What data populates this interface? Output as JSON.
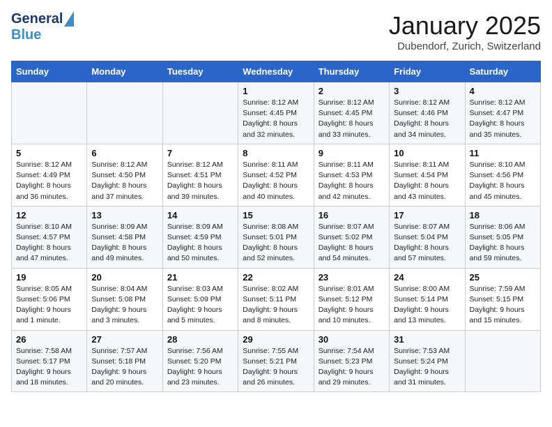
{
  "header": {
    "logo_line1": "General",
    "logo_line2": "Blue",
    "title": "January 2025",
    "subtitle": "Dubendorf, Zurich, Switzerland"
  },
  "days_of_week": [
    "Sunday",
    "Monday",
    "Tuesday",
    "Wednesday",
    "Thursday",
    "Friday",
    "Saturday"
  ],
  "weeks": [
    [
      {
        "date": "",
        "info": ""
      },
      {
        "date": "",
        "info": ""
      },
      {
        "date": "",
        "info": ""
      },
      {
        "date": "1",
        "info": "Sunrise: 8:12 AM\nSunset: 4:45 PM\nDaylight: 8 hours\nand 32 minutes."
      },
      {
        "date": "2",
        "info": "Sunrise: 8:12 AM\nSunset: 4:45 PM\nDaylight: 8 hours\nand 33 minutes."
      },
      {
        "date": "3",
        "info": "Sunrise: 8:12 AM\nSunset: 4:46 PM\nDaylight: 8 hours\nand 34 minutes."
      },
      {
        "date": "4",
        "info": "Sunrise: 8:12 AM\nSunset: 4:47 PM\nDaylight: 8 hours\nand 35 minutes."
      }
    ],
    [
      {
        "date": "5",
        "info": "Sunrise: 8:12 AM\nSunset: 4:49 PM\nDaylight: 8 hours\nand 36 minutes."
      },
      {
        "date": "6",
        "info": "Sunrise: 8:12 AM\nSunset: 4:50 PM\nDaylight: 8 hours\nand 37 minutes."
      },
      {
        "date": "7",
        "info": "Sunrise: 8:12 AM\nSunset: 4:51 PM\nDaylight: 8 hours\nand 39 minutes."
      },
      {
        "date": "8",
        "info": "Sunrise: 8:11 AM\nSunset: 4:52 PM\nDaylight: 8 hours\nand 40 minutes."
      },
      {
        "date": "9",
        "info": "Sunrise: 8:11 AM\nSunset: 4:53 PM\nDaylight: 8 hours\nand 42 minutes."
      },
      {
        "date": "10",
        "info": "Sunrise: 8:11 AM\nSunset: 4:54 PM\nDaylight: 8 hours\nand 43 minutes."
      },
      {
        "date": "11",
        "info": "Sunrise: 8:10 AM\nSunset: 4:56 PM\nDaylight: 8 hours\nand 45 minutes."
      }
    ],
    [
      {
        "date": "12",
        "info": "Sunrise: 8:10 AM\nSunset: 4:57 PM\nDaylight: 8 hours\nand 47 minutes."
      },
      {
        "date": "13",
        "info": "Sunrise: 8:09 AM\nSunset: 4:58 PM\nDaylight: 8 hours\nand 49 minutes."
      },
      {
        "date": "14",
        "info": "Sunrise: 8:09 AM\nSunset: 4:59 PM\nDaylight: 8 hours\nand 50 minutes."
      },
      {
        "date": "15",
        "info": "Sunrise: 8:08 AM\nSunset: 5:01 PM\nDaylight: 8 hours\nand 52 minutes."
      },
      {
        "date": "16",
        "info": "Sunrise: 8:07 AM\nSunset: 5:02 PM\nDaylight: 8 hours\nand 54 minutes."
      },
      {
        "date": "17",
        "info": "Sunrise: 8:07 AM\nSunset: 5:04 PM\nDaylight: 8 hours\nand 57 minutes."
      },
      {
        "date": "18",
        "info": "Sunrise: 8:06 AM\nSunset: 5:05 PM\nDaylight: 8 hours\nand 59 minutes."
      }
    ],
    [
      {
        "date": "19",
        "info": "Sunrise: 8:05 AM\nSunset: 5:06 PM\nDaylight: 9 hours\nand 1 minute."
      },
      {
        "date": "20",
        "info": "Sunrise: 8:04 AM\nSunset: 5:08 PM\nDaylight: 9 hours\nand 3 minutes."
      },
      {
        "date": "21",
        "info": "Sunrise: 8:03 AM\nSunset: 5:09 PM\nDaylight: 9 hours\nand 5 minutes."
      },
      {
        "date": "22",
        "info": "Sunrise: 8:02 AM\nSunset: 5:11 PM\nDaylight: 9 hours\nand 8 minutes."
      },
      {
        "date": "23",
        "info": "Sunrise: 8:01 AM\nSunset: 5:12 PM\nDaylight: 9 hours\nand 10 minutes."
      },
      {
        "date": "24",
        "info": "Sunrise: 8:00 AM\nSunset: 5:14 PM\nDaylight: 9 hours\nand 13 minutes."
      },
      {
        "date": "25",
        "info": "Sunrise: 7:59 AM\nSunset: 5:15 PM\nDaylight: 9 hours\nand 15 minutes."
      }
    ],
    [
      {
        "date": "26",
        "info": "Sunrise: 7:58 AM\nSunset: 5:17 PM\nDaylight: 9 hours\nand 18 minutes."
      },
      {
        "date": "27",
        "info": "Sunrise: 7:57 AM\nSunset: 5:18 PM\nDaylight: 9 hours\nand 20 minutes."
      },
      {
        "date": "28",
        "info": "Sunrise: 7:56 AM\nSunset: 5:20 PM\nDaylight: 9 hours\nand 23 minutes."
      },
      {
        "date": "29",
        "info": "Sunrise: 7:55 AM\nSunset: 5:21 PM\nDaylight: 9 hours\nand 26 minutes."
      },
      {
        "date": "30",
        "info": "Sunrise: 7:54 AM\nSunset: 5:23 PM\nDaylight: 9 hours\nand 29 minutes."
      },
      {
        "date": "31",
        "info": "Sunrise: 7:53 AM\nSunset: 5:24 PM\nDaylight: 9 hours\nand 31 minutes."
      },
      {
        "date": "",
        "info": ""
      }
    ]
  ]
}
